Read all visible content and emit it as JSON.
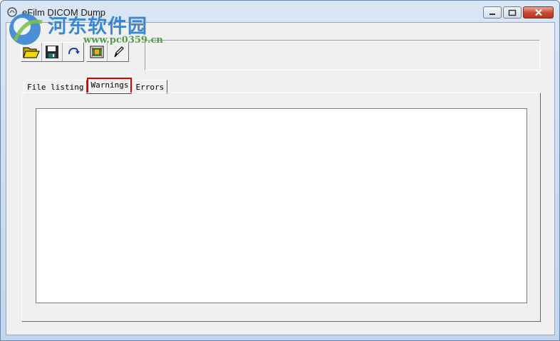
{
  "window": {
    "title": "eFilm DICOM Dump",
    "controls": [
      "minimize",
      "maximize",
      "close"
    ]
  },
  "watermark": {
    "text": "河东软件园",
    "url": "www.pc0359.cn"
  },
  "toolbar": {
    "buttons": [
      {
        "name": "open-folder-icon",
        "tooltip": ""
      },
      {
        "name": "save-disk-icon",
        "tooltip": ""
      },
      {
        "name": "refresh-arrow-icon",
        "tooltip": ""
      },
      {
        "name": "image-grid-icon",
        "tooltip": ""
      },
      {
        "name": "edit-pencil-icon",
        "tooltip": ""
      }
    ]
  },
  "tabs": {
    "items": [
      {
        "label": "File listing"
      },
      {
        "label": "Warnings"
      },
      {
        "label": "Errors"
      }
    ],
    "active_index": 1
  },
  "colors": {
    "highlight_border": "#e00000",
    "watermark_blue": "#2e7fd0",
    "watermark_green": "#3a9a2e"
  }
}
